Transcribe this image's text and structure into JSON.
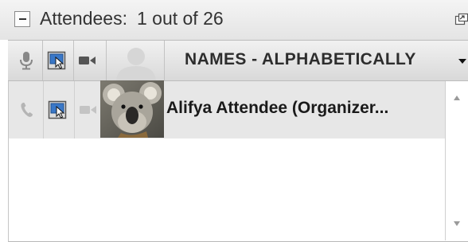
{
  "header": {
    "title_label": "Attendees:",
    "count_text": "1 out of 26",
    "collapse_icon": "minus-icon",
    "popout_icon": "popout-window-icon"
  },
  "columns": {
    "audio_icon": "microphone-icon",
    "presenter_icon": "presenter-screen-icon",
    "video_icon": "video-camera-icon",
    "avatar_icon": "default-avatar-icon",
    "sort_label": "NAMES - ALPHABETICALLY",
    "sort_icon": "chevron-down-icon"
  },
  "attendees": [
    {
      "name": "Alifya Attendee (Organizer...",
      "audio_icon": "phone-icon",
      "presenter_icon": "presenter-screen-icon",
      "video_icon": "video-camera-icon",
      "avatar": "koala-photo"
    }
  ],
  "colors": {
    "header_bg": "#e9e9e9",
    "row_selected_bg": "#e7e7e7",
    "presenter_blue": "#3a78c8",
    "text": "#333333"
  }
}
